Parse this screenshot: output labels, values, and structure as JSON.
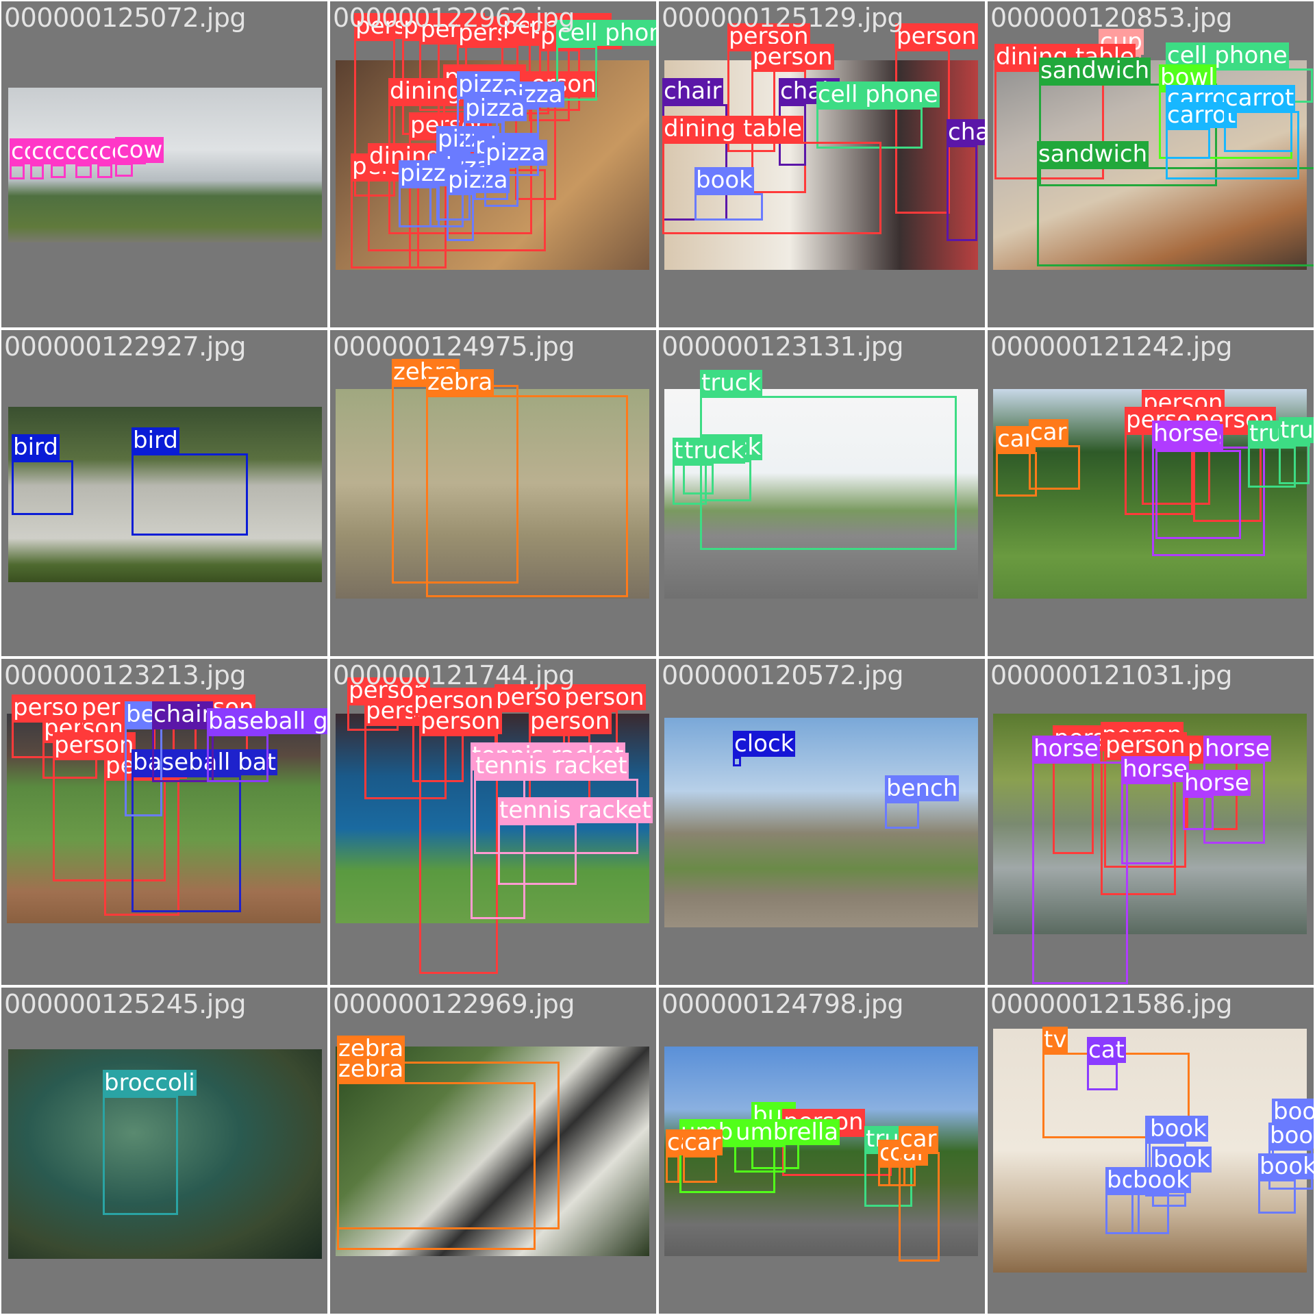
{
  "colors": {
    "background": "#777777",
    "filename_text": "#e4e4e4",
    "label_text": "#ffffff",
    "person": "#ff3a3a",
    "cow": "#ff37c7",
    "dining table": "#ff3a3a",
    "pizza": "#6a7bff",
    "cell phone": "#3ddc84",
    "chair": "#5b16a8",
    "book": "#6a7bff",
    "cup": "#ff9d9d",
    "sandwich": "#21a83b",
    "bowl": "#52ff1a",
    "carrot": "#18b7ff",
    "bird": "#0a1cd6",
    "zebra": "#ff7a1a",
    "truck": "#3ddc84",
    "horse": "#b03bff",
    "car": "#ff7a1a",
    "bench": "#6a7bff",
    "baseball bat": "#1e22cc",
    "baseball glove": "#8b3bff",
    "tennis racket": "#ff9bd2",
    "clock": "#1616d6",
    "broccoli": "#2aa4a4",
    "bus": "#52ff1a",
    "umbrella": "#52ff1a",
    "tv": "#ff7a1a",
    "cat": "#8b3bff"
  },
  "tiles": [
    {
      "file": "000000125072.jpg",
      "bg": "linear-gradient(#c9cdd0 0%, #dfe2e4 40%, #b5bcc0 60%, #4f7040 70%, #607a3c 90%, #7a7a70 100%)",
      "detections": [
        {
          "label": "cow",
          "class": "cow"
        },
        {
          "label": "cow",
          "class": "cow"
        },
        {
          "label": "cow",
          "class": "cow"
        },
        {
          "label": "cow",
          "class": "cow"
        },
        {
          "label": "cow",
          "class": "cow"
        },
        {
          "label": "cow",
          "class": "cow"
        }
      ]
    },
    {
      "file": "000000122962.jpg",
      "bg": "linear-gradient(135deg, #5a4030 0%, #a07850 40%, #c89860 70%, #7a5a40 100%)",
      "detections": [
        {
          "label": "person",
          "class": "person"
        },
        {
          "label": "person",
          "class": "person"
        },
        {
          "label": "person",
          "class": "person"
        },
        {
          "label": "person",
          "class": "person"
        },
        {
          "label": "person",
          "class": "person"
        },
        {
          "label": "person",
          "class": "person"
        },
        {
          "label": "person",
          "class": "person"
        },
        {
          "label": "person",
          "class": "person"
        },
        {
          "label": "person",
          "class": "person"
        },
        {
          "label": "person",
          "class": "person"
        },
        {
          "label": "person",
          "class": "person"
        },
        {
          "label": "cell phone",
          "class": "cell phone"
        },
        {
          "label": "dining table",
          "class": "dining table"
        },
        {
          "label": "dining table",
          "class": "dining table"
        },
        {
          "label": "pizza",
          "class": "pizza"
        },
        {
          "label": "pizza",
          "class": "pizza"
        },
        {
          "label": "pizza",
          "class": "pizza"
        },
        {
          "label": "pizza",
          "class": "pizza"
        },
        {
          "label": "pizza",
          "class": "pizza"
        },
        {
          "label": "pizza",
          "class": "pizza"
        },
        {
          "label": "pizza",
          "class": "pizza"
        },
        {
          "label": "pizza",
          "class": "pizza"
        },
        {
          "label": "pizza",
          "class": "pizza"
        }
      ]
    },
    {
      "file": "000000125129.jpg",
      "bg": "linear-gradient(90deg, #d9c8b0 0%, #f0ece4 40%, #3a3030 75%, #b84040 100%)",
      "detections": [
        {
          "label": "person",
          "class": "person"
        },
        {
          "label": "person",
          "class": "person"
        },
        {
          "label": "person",
          "class": "person"
        },
        {
          "label": "chair",
          "class": "chair"
        },
        {
          "label": "chair",
          "class": "chair"
        },
        {
          "label": "chair",
          "class": "chair"
        },
        {
          "label": "cell phone",
          "class": "cell phone"
        },
        {
          "label": "dining table",
          "class": "dining table"
        },
        {
          "label": "book",
          "class": "book"
        }
      ]
    },
    {
      "file": "000000120853.jpg",
      "bg": "linear-gradient(160deg, #909090 0%, #c0b8b0 30%, #d8c8b0 55%, #a86c40 80%, #4a3a30 100%)",
      "detections": [
        {
          "label": "cup",
          "class": "cup"
        },
        {
          "label": "dining table",
          "class": "dining table"
        },
        {
          "label": "cell phone",
          "class": "cell phone"
        },
        {
          "label": "sandwich",
          "class": "sandwich"
        },
        {
          "label": "sandwich",
          "class": "sandwich"
        },
        {
          "label": "bowl",
          "class": "bowl"
        },
        {
          "label": "carrot",
          "class": "carrot"
        },
        {
          "label": "carrot",
          "class": "carrot"
        },
        {
          "label": "carrot",
          "class": "carrot"
        }
      ]
    },
    {
      "file": "000000122927.jpg",
      "bg": "linear-gradient(#3a5030 0%, #5a7040 30%, #b8b8b0 45%, #cfcfc8 75%, #4f6a30 90%, #3a5020 100%)",
      "detections": [
        {
          "label": "bird",
          "class": "bird"
        },
        {
          "label": "bird",
          "class": "bird"
        }
      ]
    },
    {
      "file": "000000124975.jpg",
      "bg": "linear-gradient(#a0a880 0%, #bab090 45%, #9a9070 70%, #7a7060 100%)",
      "detections": [
        {
          "label": "zebra",
          "class": "zebra"
        },
        {
          "label": "zebra",
          "class": "zebra"
        }
      ]
    },
    {
      "file": "000000123131.jpg",
      "bg": "linear-gradient(#f6f6f6 0%, #eef2f4 40%, #7a9a60 58%, #888888 70%, #707070 100%)",
      "detections": [
        {
          "label": "truck",
          "class": "truck"
        },
        {
          "label": "truck",
          "class": "truck"
        },
        {
          "label": "truck",
          "class": "truck"
        },
        {
          "label": "truck",
          "class": "truck"
        }
      ]
    },
    {
      "file": "000000121242.jpg",
      "bg": "linear-gradient(#c8d8e8 0%, #2e5a28 30%, #4a7a30 55%, #6a9a40 80%, #5a8a38 100%)",
      "detections": [
        {
          "label": "person",
          "class": "person"
        },
        {
          "label": "person",
          "class": "person"
        },
        {
          "label": "person",
          "class": "person"
        },
        {
          "label": "horse",
          "class": "horse"
        },
        {
          "label": "horse",
          "class": "horse"
        },
        {
          "label": "car",
          "class": "car"
        },
        {
          "label": "car",
          "class": "car"
        },
        {
          "label": "truck",
          "class": "truck"
        },
        {
          "label": "truck",
          "class": "truck"
        }
      ]
    },
    {
      "file": "000000123213.jpg",
      "bg": "linear-gradient(#3a3a40 0%, #5a4a40 20%, #5a8a40 35%, #6a9a48 60%, #a07050 85%, #8a6040 100%)",
      "detections": [
        {
          "label": "person",
          "class": "person"
        },
        {
          "label": "person",
          "class": "person"
        },
        {
          "label": "person",
          "class": "person"
        },
        {
          "label": "person",
          "class": "person"
        },
        {
          "label": "person",
          "class": "person"
        },
        {
          "label": "person",
          "class": "person"
        },
        {
          "label": "person",
          "class": "person"
        },
        {
          "label": "baseball bat",
          "class": "baseball bat"
        },
        {
          "label": "bench",
          "class": "bench"
        },
        {
          "label": "chair",
          "class": "chair"
        },
        {
          "label": "baseball glove",
          "class": "baseball glove"
        }
      ]
    },
    {
      "file": "000000121744.jpg",
      "bg": "linear-gradient(#3a2a30 0%, #1a5a8a 30%, #1a6aa0 55%, #5a9a40 75%, #6aa048 100%)",
      "detections": [
        {
          "label": "person",
          "class": "person"
        },
        {
          "label": "person",
          "class": "person"
        },
        {
          "label": "person",
          "class": "person"
        },
        {
          "label": "person",
          "class": "person"
        },
        {
          "label": "person",
          "class": "person"
        },
        {
          "label": "person",
          "class": "person"
        },
        {
          "label": "person",
          "class": "person"
        },
        {
          "label": "tennis racket",
          "class": "tennis racket"
        },
        {
          "label": "tennis racket",
          "class": "tennis racket"
        },
        {
          "label": "tennis racket",
          "class": "tennis racket"
        }
      ]
    },
    {
      "file": "000000120572.jpg",
      "bg": "linear-gradient(#7aa8d8 0%, #b8d0e8 35%, #8a8470 55%, #6a8a48 72%, #8a8070 85%, #9a9080 100%)",
      "detections": [
        {
          "label": "clock",
          "class": "clock"
        },
        {
          "label": "bench",
          "class": "bench"
        }
      ]
    },
    {
      "file": "000000121031.jpg",
      "bg": "linear-gradient(#5a7a30 0%, #8aa050 30%, #7a8a70 50%, #a0a8a8 70%, #5a6a60 100%)",
      "detections": [
        {
          "label": "person",
          "class": "person"
        },
        {
          "label": "person",
          "class": "person"
        },
        {
          "label": "person",
          "class": "person"
        },
        {
          "label": "person",
          "class": "person"
        },
        {
          "label": "horse",
          "class": "horse"
        },
        {
          "label": "horse",
          "class": "horse"
        },
        {
          "label": "horse",
          "class": "horse"
        },
        {
          "label": "horse",
          "class": "horse"
        }
      ]
    },
    {
      "file": "000000125245.jpg",
      "bg": "radial-gradient(ellipse at 40% 40%, #5a8a70 0%, #2a5a50 40%, #3a4a30 70%, #1a2a20 100%)",
      "detections": [
        {
          "label": "broccoli",
          "class": "broccoli"
        }
      ]
    },
    {
      "file": "000000122969.jpg",
      "bg": "linear-gradient(135deg, #2a4a20 0%, #5a7a40 30%, #d8d8d0 50%, #303030 60%, #e0e0d8 75%, #2a3a20 100%)",
      "detections": [
        {
          "label": "zebra",
          "class": "zebra"
        },
        {
          "label": "zebra",
          "class": "zebra"
        }
      ]
    },
    {
      "file": "000000124798.jpg",
      "bg": "linear-gradient(#5a90d8 0%, #8ab0e0 30%, #3a6a28 50%, #4a6a30 65%, #707070 85%, #606060 100%)",
      "detections": [
        {
          "label": "bus",
          "class": "bus"
        },
        {
          "label": "person",
          "class": "person"
        },
        {
          "label": "umbrella",
          "class": "umbrella"
        },
        {
          "label": "umbrella",
          "class": "umbrella"
        },
        {
          "label": "truck",
          "class": "truck"
        },
        {
          "label": "car",
          "class": "car"
        },
        {
          "label": "car",
          "class": "car"
        },
        {
          "label": "car",
          "class": "car"
        },
        {
          "label": "car",
          "class": "car"
        },
        {
          "label": "car",
          "class": "car"
        }
      ]
    },
    {
      "file": "000000121586.jpg",
      "bg": "linear-gradient(#e8e0d4 0%, #efe8dc 50%, #c8b49a 75%, #8a6a48 100%)",
      "detections": [
        {
          "label": "tv",
          "class": "tv"
        },
        {
          "label": "cat",
          "class": "cat"
        },
        {
          "label": "book",
          "class": "book"
        },
        {
          "label": "book",
          "class": "book"
        },
        {
          "label": "book",
          "class": "book"
        },
        {
          "label": "book",
          "class": "book"
        },
        {
          "label": "book",
          "class": "book"
        },
        {
          "label": "book",
          "class": "book"
        },
        {
          "label": "book",
          "class": "book"
        },
        {
          "label": "book",
          "class": "book"
        }
      ]
    }
  ]
}
